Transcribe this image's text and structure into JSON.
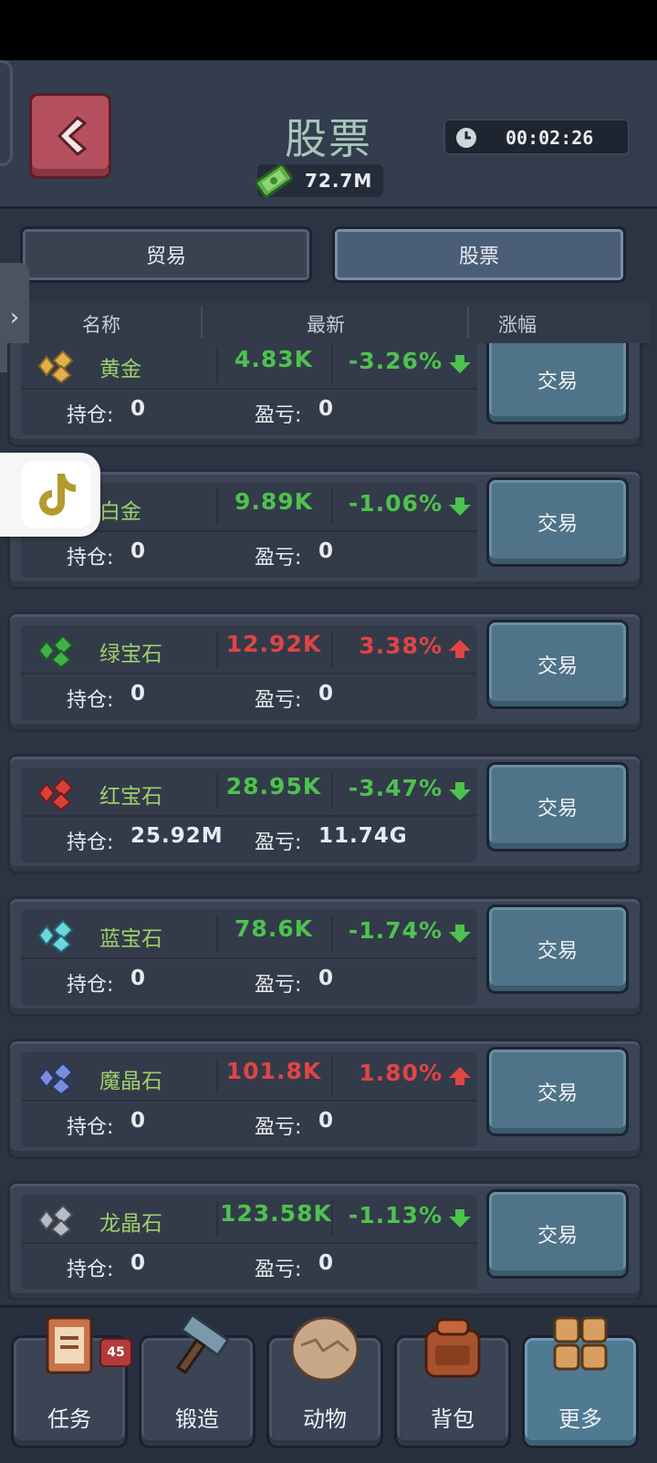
{
  "header": {
    "title": "股票",
    "money": "72.7M",
    "timer": "00:02:26",
    "back_icon": "chevron-left-icon"
  },
  "tabs": [
    {
      "label": "贸易",
      "active": false
    },
    {
      "label": "股票",
      "active": true
    }
  ],
  "columns": {
    "name": "名称",
    "latest": "最新",
    "change": "涨幅"
  },
  "labels": {
    "holding": "持仓:",
    "pnl": "盈亏:",
    "trade": "交易"
  },
  "stocks": [
    {
      "name": "黄金",
      "price": "4.83K",
      "change": "-3.26%",
      "direction": "down",
      "holding": "0",
      "pnl": "0",
      "icon": "gold-ore-icon"
    },
    {
      "name": "白金",
      "price": "9.89K",
      "change": "-1.06%",
      "direction": "down",
      "holding": "0",
      "pnl": "0",
      "icon": "platinum-ore-icon"
    },
    {
      "name": "绿宝石",
      "price": "12.92K",
      "change": "3.38%",
      "direction": "up",
      "holding": "0",
      "pnl": "0",
      "icon": "emerald-icon"
    },
    {
      "name": "红宝石",
      "price": "28.95K",
      "change": "-3.47%",
      "direction": "down",
      "holding": "25.92M",
      "pnl": "11.74G",
      "icon": "ruby-icon"
    },
    {
      "name": "蓝宝石",
      "price": "78.6K",
      "change": "-1.74%",
      "direction": "down",
      "holding": "0",
      "pnl": "0",
      "icon": "sapphire-icon"
    },
    {
      "name": "魔晶石",
      "price": "101.8K",
      "change": "1.80%",
      "direction": "up",
      "holding": "0",
      "pnl": "0",
      "icon": "magic-crystal-icon"
    },
    {
      "name": "龙晶石",
      "price": "123.58K",
      "change": "-1.13%",
      "direction": "down",
      "holding": "0",
      "pnl": "0",
      "icon": "dragon-crystal-icon"
    }
  ],
  "nav": [
    {
      "label": "任务",
      "icon": "quest-book-icon",
      "badge": "45",
      "active": false
    },
    {
      "label": "锻造",
      "icon": "hammer-icon",
      "active": false
    },
    {
      "label": "动物",
      "icon": "egg-icon",
      "active": false
    },
    {
      "label": "背包",
      "icon": "backpack-icon",
      "active": false
    },
    {
      "label": "更多",
      "icon": "grid-icon",
      "active": true
    }
  ],
  "colors": {
    "up": "#e14444",
    "down": "#4ec24e",
    "accent": "#4f7388",
    "name_green": "#9fcf6c"
  }
}
